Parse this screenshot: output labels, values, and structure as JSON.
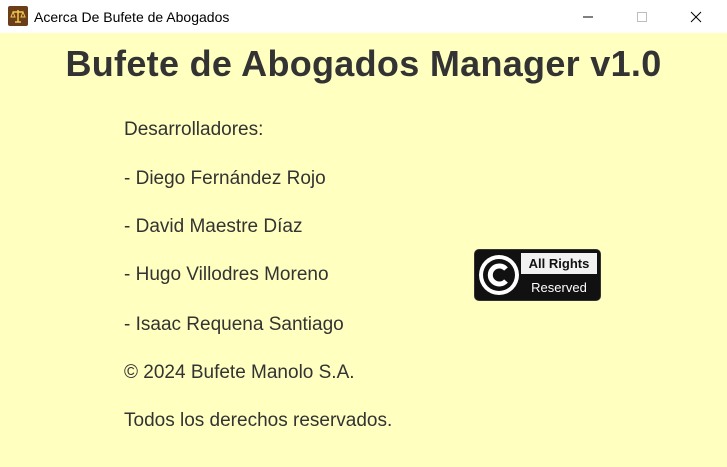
{
  "window": {
    "title": "Acerca De Bufete de Abogados"
  },
  "about": {
    "heading": "Bufete de Abogados Manager v1.0",
    "developers_label": "Desarrolladores:",
    "developers": [
      "- Diego Fernández Rojo",
      "- David Maestre Díaz",
      "- Hugo Villodres Moreno",
      "- Isaac Requena Santiago"
    ],
    "copyright": "© 2024 Bufete Manolo S.A.",
    "rights": "Todos los derechos reservados."
  },
  "badge": {
    "line1": "All Rights",
    "line2": "Reserved"
  },
  "icons": {
    "app": "scales-of-justice-icon",
    "minimize": "minimize-icon",
    "maximize": "maximize-icon",
    "close": "close-icon",
    "copyright": "copyright-icon"
  },
  "colors": {
    "background": "#ffffc0",
    "text": "#333333"
  }
}
